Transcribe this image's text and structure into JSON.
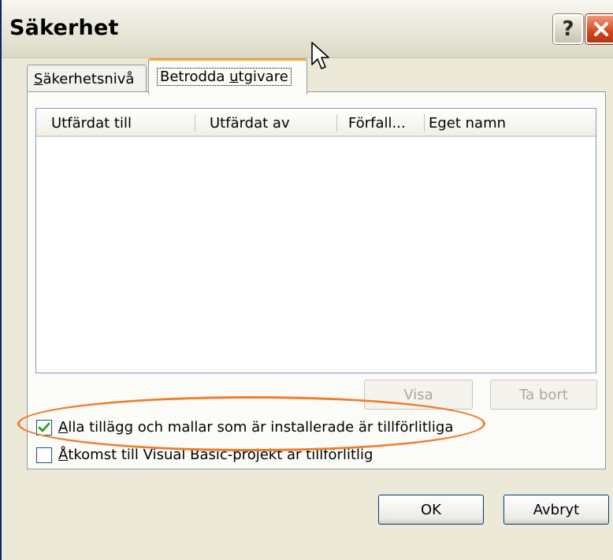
{
  "window": {
    "title": "Säkerhet"
  },
  "title_buttons": {
    "help_label": "?",
    "close_icon": "close-icon"
  },
  "tabs": [
    {
      "label": "Säkerhetsnivå",
      "mnemonic": "S",
      "rest": "äkerhetsnivå",
      "active": false
    },
    {
      "label": "Betrodda utgivare",
      "pre": "Betrodda ",
      "mnemonic": "u",
      "rest": "tgivare",
      "active": true
    }
  ],
  "listview": {
    "columns": [
      "Utfärdat till",
      "Utfärdat av",
      "Förfall...",
      "Eget namn"
    ],
    "rows": []
  },
  "buttons": {
    "visa": "Visa",
    "ta_bort": "Ta bort",
    "ok": "OK",
    "avbryt": "Avbryt"
  },
  "checkboxes": [
    {
      "mnemonic": "A",
      "rest": "lla tillägg och mallar som är installerade är tillförlitliga",
      "checked": true
    },
    {
      "mnemonic": "Å",
      "rest": "tkomst till Visual Basic-projekt är tillförlitlig",
      "checked": false
    }
  ],
  "colors": {
    "highlight": "#ee7d2e",
    "tab_accent": "#f1a83a",
    "check_mark": "#21a121"
  }
}
